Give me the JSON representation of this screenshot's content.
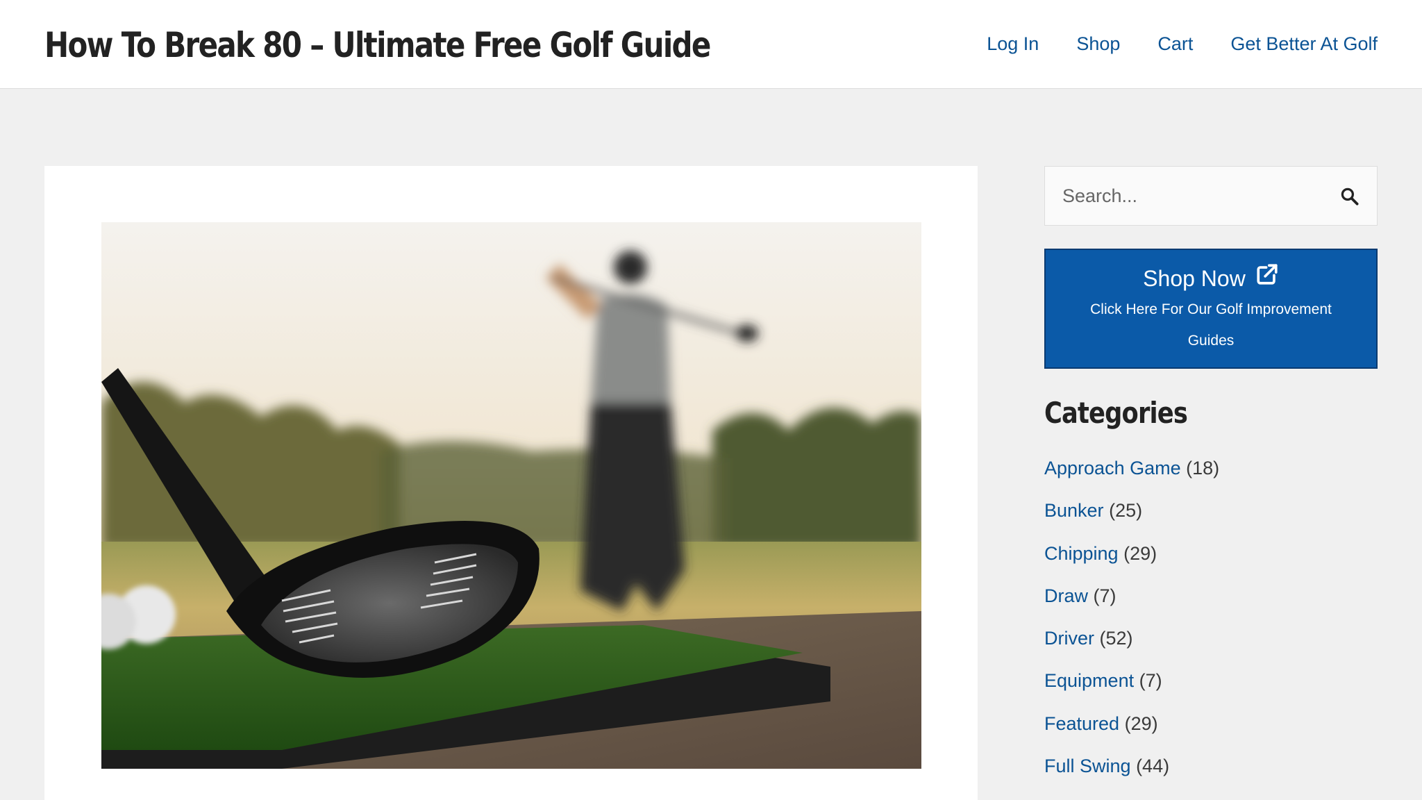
{
  "header": {
    "site_title": "How To Break 80 – Ultimate Free Golf Guide",
    "nav": [
      {
        "label": "Log In"
      },
      {
        "label": "Shop"
      },
      {
        "label": "Cart"
      },
      {
        "label": "Get Better At Golf"
      }
    ]
  },
  "main": {
    "featured_image_alt": "",
    "icons": {
      "image": "golf-driver-photo"
    }
  },
  "sidebar": {
    "search": {
      "placeholder": "Search...",
      "icon": "search-icon"
    },
    "shop_box": {
      "title": "Shop Now",
      "icon": "external-link-icon",
      "subtitle": "Click Here For Our Golf Improvement Guides"
    },
    "categories_heading": "Categories",
    "categories": [
      {
        "name": "Approach Game",
        "count": "(18)"
      },
      {
        "name": "Bunker",
        "count": "(25)"
      },
      {
        "name": "Chipping",
        "count": "(29)"
      },
      {
        "name": "Draw",
        "count": "(7)"
      },
      {
        "name": "Driver",
        "count": "(52)"
      },
      {
        "name": "Equipment",
        "count": "(7)"
      },
      {
        "name": "Featured",
        "count": "(29)"
      },
      {
        "name": "Full Swing",
        "count": "(44)"
      }
    ]
  },
  "colors": {
    "link": "#0b5394",
    "shop_bg": "#0b5aa8",
    "page_bg": "#f0f0f0",
    "title": "#222222"
  }
}
